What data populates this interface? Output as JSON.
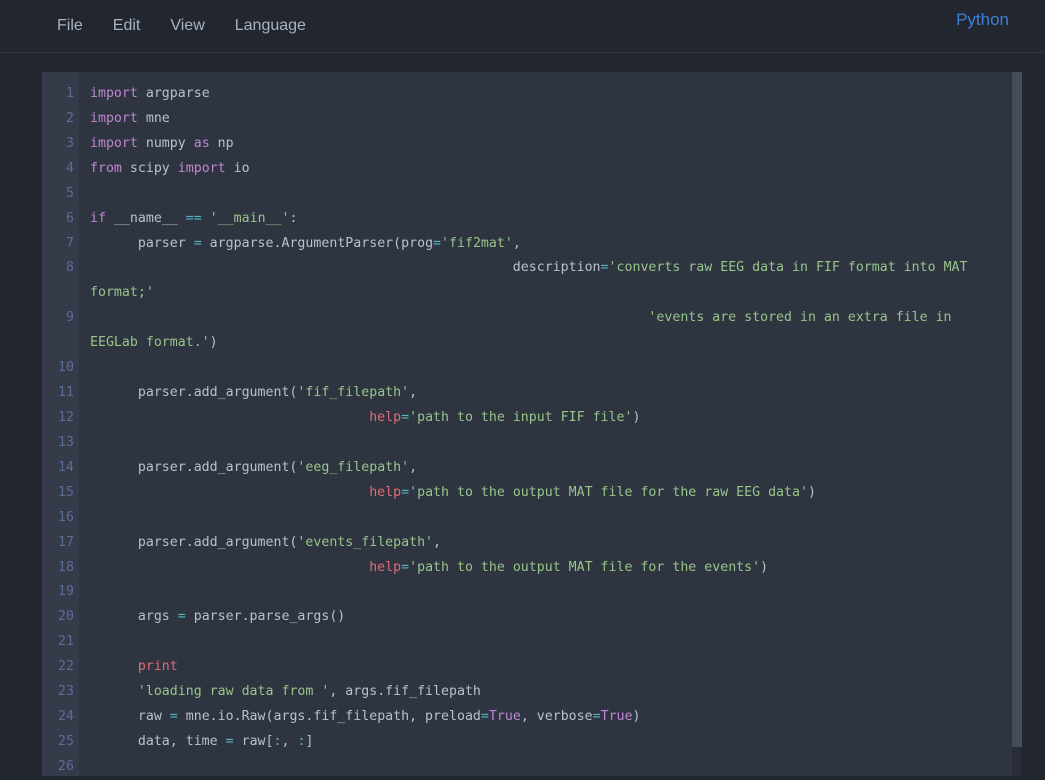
{
  "menu": {
    "items": [
      {
        "label": "File"
      },
      {
        "label": "Edit"
      },
      {
        "label": "View"
      },
      {
        "label": "Language"
      }
    ],
    "language_indicator": "Python"
  },
  "colors": {
    "page_bg": "#22262e",
    "editor_bg": "#2f3441",
    "gutter_bg": "#353b49",
    "line_number": "#5a6c99",
    "text_default": "#b9c0cb",
    "keyword": "#bf87d2",
    "string": "#97c589",
    "operator": "#56b6c2",
    "builtin_red": "#e06c75",
    "language_indicator_blue": "#3f7ed8",
    "scrollbar_thumb": "#454c5c"
  },
  "editor": {
    "rows": [
      {
        "n": "1",
        "segs": [
          [
            "k",
            "import"
          ],
          [
            "p",
            " argparse"
          ]
        ]
      },
      {
        "n": "2",
        "segs": [
          [
            "k",
            "import"
          ],
          [
            "p",
            " mne"
          ]
        ]
      },
      {
        "n": "3",
        "segs": [
          [
            "k",
            "import"
          ],
          [
            "p",
            " numpy "
          ],
          [
            "k",
            "as"
          ],
          [
            "p",
            " np"
          ]
        ]
      },
      {
        "n": "4",
        "segs": [
          [
            "k",
            "from"
          ],
          [
            "p",
            " scipy "
          ],
          [
            "k",
            "import"
          ],
          [
            "p",
            " io"
          ]
        ]
      },
      {
        "n": "5",
        "segs": []
      },
      {
        "n": "6",
        "segs": [
          [
            "k",
            "if"
          ],
          [
            "p",
            " __name__ "
          ],
          [
            "o",
            "=="
          ],
          [
            "p",
            " "
          ],
          [
            "s",
            "'__main__'"
          ],
          [
            "p",
            ":"
          ]
        ]
      },
      {
        "n": "7",
        "segs": [
          [
            "p",
            "      parser "
          ],
          [
            "o",
            "="
          ],
          [
            "p",
            " argparse.ArgumentParser(prog"
          ],
          [
            "o",
            "="
          ],
          [
            "s",
            "'fif2mat'"
          ],
          [
            "p",
            ","
          ]
        ]
      },
      {
        "n": "8",
        "segs": [
          [
            "p",
            "                                                     description"
          ],
          [
            "o",
            "="
          ],
          [
            "s",
            "'converts raw EEG data in FIF format into MAT"
          ]
        ]
      },
      {
        "n": "",
        "segs": [
          [
            "s",
            "format;'"
          ]
        ]
      },
      {
        "n": "9",
        "segs": [
          [
            "p",
            "                                                                      "
          ],
          [
            "s",
            "'events are stored in an extra file in"
          ]
        ]
      },
      {
        "n": "",
        "segs": [
          [
            "s",
            "EEGLab format.'"
          ],
          [
            "p",
            ")"
          ]
        ]
      },
      {
        "n": "10",
        "segs": []
      },
      {
        "n": "11",
        "segs": [
          [
            "p",
            "      parser.add_argument("
          ],
          [
            "s",
            "'fif_filepath'"
          ],
          [
            "p",
            ","
          ]
        ]
      },
      {
        "n": "12",
        "segs": [
          [
            "p",
            "                                   "
          ],
          [
            "r",
            "help"
          ],
          [
            "o",
            "="
          ],
          [
            "s",
            "'path to the input FIF file'"
          ],
          [
            "p",
            ")"
          ]
        ]
      },
      {
        "n": "13",
        "segs": []
      },
      {
        "n": "14",
        "segs": [
          [
            "p",
            "      parser.add_argument("
          ],
          [
            "s",
            "'eeg_filepath'"
          ],
          [
            "p",
            ","
          ]
        ]
      },
      {
        "n": "15",
        "segs": [
          [
            "p",
            "                                   "
          ],
          [
            "r",
            "help"
          ],
          [
            "o",
            "="
          ],
          [
            "s",
            "'path to the output MAT file for the raw EEG data'"
          ],
          [
            "p",
            ")"
          ]
        ]
      },
      {
        "n": "16",
        "segs": []
      },
      {
        "n": "17",
        "segs": [
          [
            "p",
            "      parser.add_argument("
          ],
          [
            "s",
            "'events_filepath'"
          ],
          [
            "p",
            ","
          ]
        ]
      },
      {
        "n": "18",
        "segs": [
          [
            "p",
            "                                   "
          ],
          [
            "r",
            "help"
          ],
          [
            "o",
            "="
          ],
          [
            "s",
            "'path to the output MAT file for the events'"
          ],
          [
            "p",
            ")"
          ]
        ]
      },
      {
        "n": "19",
        "segs": []
      },
      {
        "n": "20",
        "segs": [
          [
            "p",
            "      args "
          ],
          [
            "o",
            "="
          ],
          [
            "p",
            " parser.parse_args()"
          ]
        ]
      },
      {
        "n": "21",
        "segs": []
      },
      {
        "n": "22",
        "segs": [
          [
            "p",
            "      "
          ],
          [
            "r",
            "print"
          ]
        ]
      },
      {
        "n": "23",
        "segs": [
          [
            "p",
            "      "
          ],
          [
            "s",
            "'loading raw data from '"
          ],
          [
            "p",
            ", args.fif_filepath"
          ]
        ]
      },
      {
        "n": "24",
        "segs": [
          [
            "p",
            "      raw "
          ],
          [
            "o",
            "="
          ],
          [
            "p",
            " mne.io.Raw(args.fif_filepath, preload"
          ],
          [
            "o",
            "="
          ],
          [
            "k",
            "True"
          ],
          [
            "p",
            ", verbose"
          ],
          [
            "o",
            "="
          ],
          [
            "k",
            "True"
          ],
          [
            "p",
            ")"
          ]
        ]
      },
      {
        "n": "25",
        "segs": [
          [
            "p",
            "      data, time "
          ],
          [
            "o",
            "="
          ],
          [
            "p",
            " raw["
          ],
          [
            "o",
            ":"
          ],
          [
            "p",
            ", "
          ],
          [
            "o",
            ":"
          ],
          [
            "p",
            "]"
          ]
        ]
      },
      {
        "n": "26",
        "segs": []
      }
    ]
  }
}
